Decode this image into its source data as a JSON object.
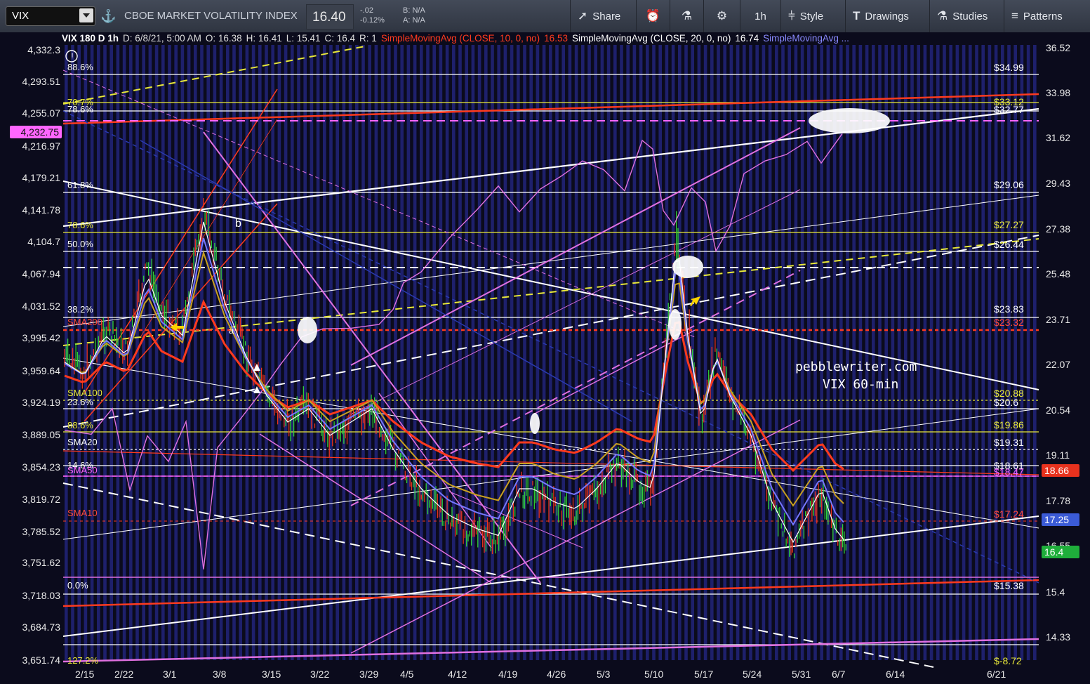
{
  "toolbar": {
    "symbol": "VIX",
    "description": "CBOE MARKET VOLATILITY INDEX",
    "last_price": "16.40",
    "change": "-.02",
    "change_pct": "-0.12%",
    "bid": "B: N/A",
    "ask": "A: N/A",
    "share_label": "Share",
    "interval_label": "1h",
    "style_label": "Style",
    "drawings_label": "Drawings",
    "studies_label": "Studies",
    "patterns_label": "Patterns",
    "icons": [
      "dropdown-icon",
      "link-icon",
      "share-icon",
      "alert-icon",
      "flask-icon",
      "gear-icon",
      "style-icon",
      "drawings-icon",
      "studies-icon",
      "patterns-icon"
    ]
  },
  "header": {
    "title": "VIX 180 D 1h",
    "date": "D: 6/8/21, 5:00 AM",
    "open": "O: 16.38",
    "high": "H: 16.41",
    "low": "L: 15.41",
    "close": "C: 16.4",
    "range": "R: 1",
    "sma10": "SimpleMovingAvg (CLOSE, 10, 0, no)",
    "sma10_val": "16.53",
    "sma20": "SimpleMovingAvg (CLOSE, 20, 0, no)",
    "sma20_val": "16.74",
    "sma50": "SimpleMovingAvg ..."
  },
  "left_axis": [
    "4,332.3",
    "4,293.51",
    "4,255.07",
    "4,216.97",
    "4,179.21",
    "4,141.78",
    "4,104.7",
    "4,067.94",
    "4,031.52",
    "3,995.42",
    "3,959.64",
    "3,924.19",
    "3,889.05",
    "3,854.23",
    "3,819.72",
    "3,785.52",
    "3,751.62",
    "3,718.03",
    "3,684.73",
    "3,651.74"
  ],
  "left_highlight": "4,232.75",
  "right_axis": [
    "36.52",
    "33.98",
    "31.62",
    "29.43",
    "27.38",
    "25.48",
    "23.71",
    "22.07",
    "20.54",
    "19.11",
    "17.78",
    "16.55",
    "15.4",
    "14.33"
  ],
  "dates": [
    "2/15",
    "2/22",
    "3/1",
    "3/8",
    "3/15",
    "3/22",
    "3/29",
    "4/5",
    "4/12",
    "4/19",
    "4/26",
    "5/3",
    "5/10",
    "5/17",
    "5/24",
    "5/31",
    "6/7",
    "6/14",
    "6/21"
  ],
  "fib_left": [
    {
      "text": "88.6%",
      "color": "#ffffff"
    },
    {
      "text": "70.7%",
      "color": "#e8e83a"
    },
    {
      "text": "78.6%",
      "color": "#ffffff"
    },
    {
      "text": "61.8%",
      "color": "#ffffff"
    },
    {
      "text": "78.6%",
      "color": "#e8e83a"
    },
    {
      "text": "50.0%",
      "color": "#ffffff"
    },
    {
      "text": "38.2%",
      "color": "#ffffff"
    },
    {
      "text": "SMA200",
      "color": "#ff4a3a"
    },
    {
      "text": "SMA100",
      "color": "#e8e83a"
    },
    {
      "text": "23.6%",
      "color": "#ffffff"
    },
    {
      "text": "88.6%",
      "color": "#e8e83a"
    },
    {
      "text": "SMA20",
      "color": "#ffffff"
    },
    {
      "text": "14.6%",
      "color": "#ffffff"
    },
    {
      "text": "SMA50",
      "color": "#ff66ff"
    },
    {
      "text": "SMA10",
      "color": "#ff4a3a"
    },
    {
      "text": "0.0%",
      "color": "#ffffff"
    },
    {
      "text": "127.2%",
      "color": "#e8e83a"
    }
  ],
  "fib_right": [
    {
      "text": "$34.99",
      "color": "#ffffff"
    },
    {
      "text": "$33.12",
      "color": "#e8e83a"
    },
    {
      "text": "$32.77",
      "color": "#ffffff"
    },
    {
      "text": "$29.06",
      "color": "#ffffff"
    },
    {
      "text": "$27.27",
      "color": "#e8e83a"
    },
    {
      "text": "$26.44",
      "color": "#ffffff"
    },
    {
      "text": "$23.83",
      "color": "#ffffff"
    },
    {
      "text": "$23.32",
      "color": "#ff4a3a"
    },
    {
      "text": "$20.88",
      "color": "#e8e83a"
    },
    {
      "text": "$20.6",
      "color": "#ffffff"
    },
    {
      "text": "$19.86",
      "color": "#e8e83a"
    },
    {
      "text": "$19.31",
      "color": "#ffffff"
    },
    {
      "text": "$18.61",
      "color": "#ffffff"
    },
    {
      "text": "$18.47",
      "color": "#ff66ff"
    },
    {
      "text": "$17.24",
      "color": "#ff4a3a"
    },
    {
      "text": "$15.38",
      "color": "#ffffff"
    },
    {
      "text": "$-8.72",
      "color": "#e8e83a"
    }
  ],
  "price_tags": [
    {
      "text": "18.66",
      "color": "#e8321e"
    },
    {
      "text": "17.25",
      "color": "#3b5bd6"
    },
    {
      "text": "16.4",
      "color": "#1fae3b"
    }
  ],
  "annotations": {
    "a": "a",
    "b": "b",
    "info": "!"
  },
  "watermark": {
    "line1": "pebblewriter.com",
    "line2": "VIX 60-min"
  },
  "colors": {
    "background": "#0b0b1c",
    "stripe": "#22247a",
    "sma10": "#ff3a1e",
    "sma20": "#ffffff",
    "sma50": "#7777ff",
    "spx": "#e070e0"
  }
}
